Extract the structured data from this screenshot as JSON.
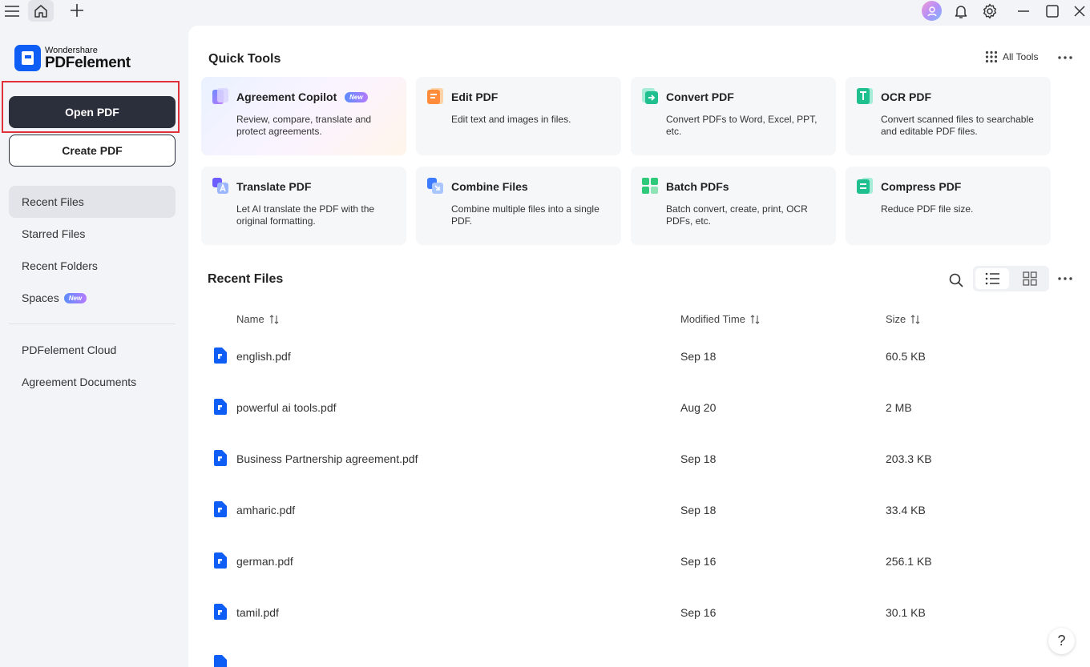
{
  "brand": {
    "top": "Wondershare",
    "main": "PDFelement"
  },
  "sidebar": {
    "open_pdf": "Open PDF",
    "create_pdf": "Create PDF",
    "items": [
      {
        "label": "Recent Files"
      },
      {
        "label": "Starred Files"
      },
      {
        "label": "Recent Folders"
      },
      {
        "label": "Spaces",
        "badge": "New"
      },
      {
        "label": "PDFelement Cloud"
      },
      {
        "label": "Agreement Documents"
      }
    ]
  },
  "quick_tools": {
    "title": "Quick Tools",
    "all_tools": "All Tools",
    "cards": [
      {
        "title": "Agreement Copilot",
        "badge": "New",
        "desc": "Review, compare, translate and protect agreements."
      },
      {
        "title": "Edit PDF",
        "desc": "Edit text and images in files."
      },
      {
        "title": "Convert PDF",
        "desc": "Convert PDFs to Word, Excel, PPT, etc."
      },
      {
        "title": "OCR PDF",
        "desc": "Convert scanned files to searchable and editable PDF files."
      },
      {
        "title": "Translate PDF",
        "desc": "Let AI translate the PDF with the original formatting."
      },
      {
        "title": "Combine Files",
        "desc": "Combine multiple files into a single PDF."
      },
      {
        "title": "Batch PDFs",
        "desc": "Batch convert, create, print, OCR PDFs, etc."
      },
      {
        "title": "Compress PDF",
        "desc": "Reduce PDF file size."
      }
    ]
  },
  "recent": {
    "title": "Recent Files",
    "columns": {
      "name": "Name",
      "modified": "Modified Time",
      "size": "Size"
    },
    "files": [
      {
        "name": "english.pdf",
        "date": "Sep 18",
        "size": "60.5 KB"
      },
      {
        "name": "powerful ai tools.pdf",
        "date": "Aug 20",
        "size": "2 MB"
      },
      {
        "name": "Business Partnership agreement.pdf",
        "date": "Sep 18",
        "size": "203.3 KB"
      },
      {
        "name": "amharic.pdf",
        "date": "Sep 18",
        "size": "33.4 KB"
      },
      {
        "name": "german.pdf",
        "date": "Sep 16",
        "size": "256.1 KB"
      },
      {
        "name": "tamil.pdf",
        "date": "Sep 16",
        "size": "30.1 KB"
      }
    ]
  },
  "help": "?",
  "colors": {
    "accent": "#0e5ef6",
    "dark_button": "#2b2e3b",
    "highlight": "#e0303a"
  }
}
